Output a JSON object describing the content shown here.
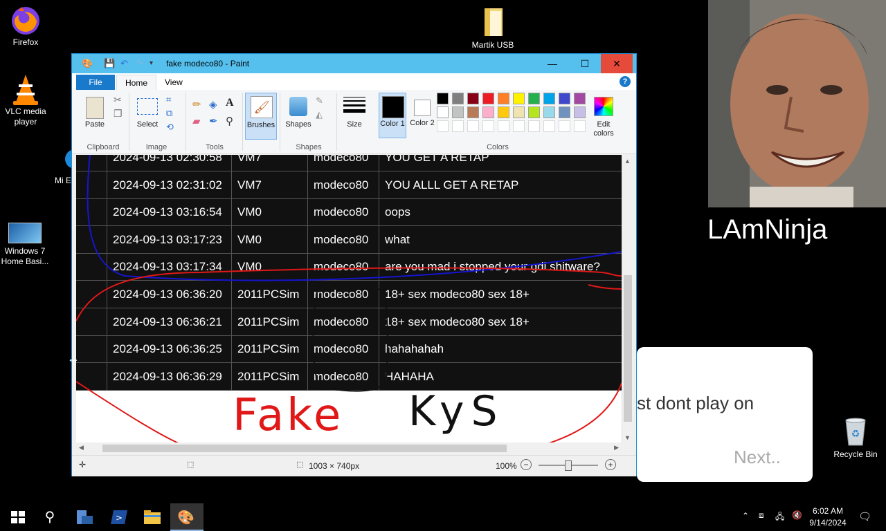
{
  "desktop": {
    "icons": [
      {
        "label": "Firefox",
        "icon": "firefox-icon"
      },
      {
        "label": "VLC media player",
        "icon": "vlc-icon"
      },
      {
        "label": "Mi E",
        "icon": "edge-icon"
      },
      {
        "label": "Windows 7 Home Basi...",
        "icon": "windows7-image-icon"
      },
      {
        "label": "Martik USB",
        "icon": "folder-icon"
      },
      {
        "label": "Recycle Bin",
        "icon": "recycle-bin-icon"
      }
    ]
  },
  "webcam": {
    "name": "LAmNinja"
  },
  "dialog": {
    "text": "st dont play on",
    "next": "Next.."
  },
  "paint": {
    "title": "fake modeco80 - Paint",
    "tabs": {
      "file": "File",
      "home": "Home",
      "view": "View"
    },
    "groups": {
      "clipboard": "Clipboard",
      "image": "Image",
      "tools": "Tools",
      "shapes": "Shapes",
      "colors": "Colors"
    },
    "buttons": {
      "paste": "Paste",
      "select": "Select",
      "brushes": "Brushes",
      "shapes": "Shapes",
      "size": "Size",
      "color1": "Color 1",
      "color2": "Color 2",
      "edit_colors": "Edit colors"
    },
    "palette": [
      "#000000",
      "#7f7f7f",
      "#880015",
      "#ed1c24",
      "#ff7f27",
      "#fff200",
      "#22b14c",
      "#00a2e8",
      "#3f48cc",
      "#a349a4",
      "#ffffff",
      "#c3c3c3",
      "#b97a57",
      "#ffaec9",
      "#ffc90e",
      "#efe4b0",
      "#b5e61d",
      "#99d9ea",
      "#7092be",
      "#c8bfe7"
    ],
    "table_rows": [
      [
        "2024-09-13 02:30:58",
        "VM7",
        "modeco80",
        "YOU GET A RETAP"
      ],
      [
        "2024-09-13 02:31:02",
        "VM7",
        "modeco80",
        "YOU ALLL GET A RETAP"
      ],
      [
        "2024-09-13 03:16:54",
        "VM0",
        "modeco80",
        "oops"
      ],
      [
        "2024-09-13 03:17:23",
        "VM0",
        "modeco80",
        "what"
      ],
      [
        "2024-09-13 03:17:34",
        "VM0",
        "modeco80",
        "are you mad i stopped your gdi shitware?"
      ],
      [
        "2024-09-13 06:36:20",
        "2011PCSim",
        "modeco80",
        "18+ sex modeco80 sex 18+"
      ],
      [
        "2024-09-13 06:36:21",
        "2011PCSim",
        "modeco80",
        "18+ sex modeco80 sex 18+"
      ],
      [
        "2024-09-13 06:36:25",
        "2011PCSim",
        "modeco80",
        "hahahahah"
      ],
      [
        "2024-09-13 06:36:29",
        "2011PCSim",
        "modeco80",
        "HAHAHA"
      ]
    ],
    "scrawl": {
      "fake": "Fake",
      "kys": "KyS"
    },
    "status": {
      "dimensions": "1003 × 740px",
      "zoom": "100%"
    }
  },
  "taskbar": {
    "time": "6:02 AM",
    "date": "9/14/2024"
  }
}
